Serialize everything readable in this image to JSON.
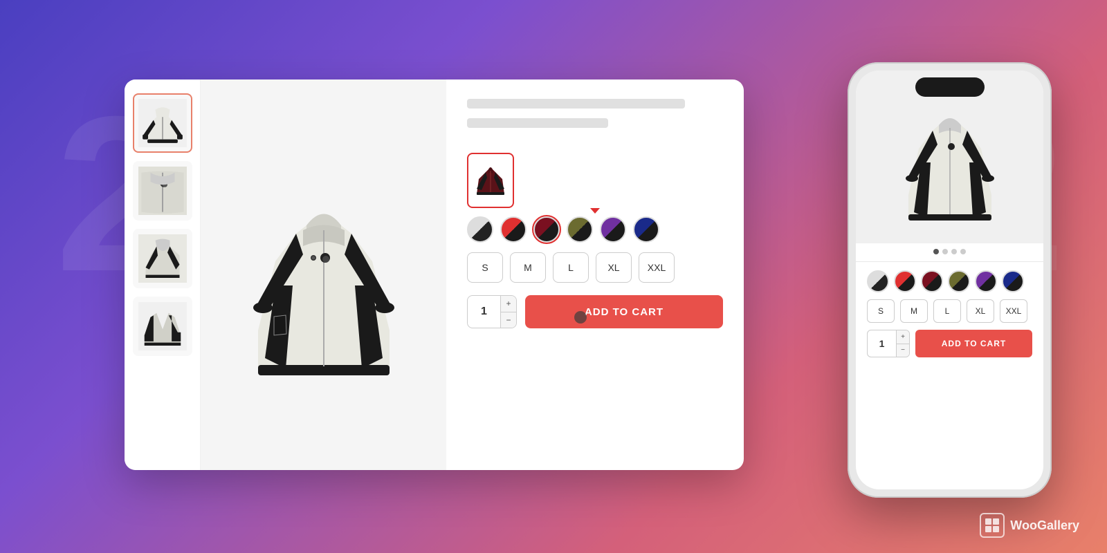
{
  "background": {
    "gradient_start": "#4a3fc0",
    "gradient_end": "#e8806a",
    "bg_text_left": "2",
    "bg_text_right": "2"
  },
  "desktop_card": {
    "thumbnails": [
      {
        "id": 1,
        "active": true,
        "alt": "Front view"
      },
      {
        "id": 2,
        "active": false,
        "alt": "Zipper detail"
      },
      {
        "id": 3,
        "active": false,
        "alt": "Side view"
      },
      {
        "id": 4,
        "active": false,
        "alt": "Back view"
      }
    ],
    "main_image_alt": "White hoodie jacket main view",
    "product": {
      "colors": [
        {
          "name": "white-black",
          "color1": "#ddd",
          "color2": "#222",
          "active": false
        },
        {
          "name": "red-black",
          "color1": "#e03030",
          "color2": "#1a1a1a",
          "active": false
        },
        {
          "name": "dark-red-black",
          "color1": "#7a1020",
          "color2": "#1a1a1a",
          "active": true
        },
        {
          "name": "olive-black",
          "color1": "#6b6b30",
          "color2": "#1a1a1a",
          "active": false
        },
        {
          "name": "purple-black",
          "color1": "#7030a0",
          "color2": "#1a1a1a",
          "active": false
        },
        {
          "name": "blue-black",
          "color1": "#1a2a8a",
          "color2": "#1a1a1a",
          "active": false
        }
      ],
      "sizes": [
        "S",
        "M",
        "L",
        "XL",
        "XXL"
      ],
      "quantity": "1",
      "add_to_cart_label": "ADD TO CART",
      "qty_plus": "+",
      "qty_minus": "−"
    }
  },
  "mobile_card": {
    "dots": [
      {
        "active": true
      },
      {
        "active": false
      },
      {
        "active": false
      },
      {
        "active": false
      }
    ],
    "product": {
      "colors": [
        {
          "name": "white-black",
          "color1": "#ddd",
          "color2": "#222",
          "active": false
        },
        {
          "name": "red-black",
          "color1": "#e03030",
          "color2": "#1a1a1a",
          "active": false
        },
        {
          "name": "dark-red-black",
          "color1": "#7a1020",
          "color2": "#1a1a1a",
          "active": false
        },
        {
          "name": "olive-black",
          "color1": "#6b6b30",
          "color2": "#1a1a1a",
          "active": false
        },
        {
          "name": "purple-black",
          "color1": "#7030a0",
          "color2": "#1a1a1a",
          "active": false
        },
        {
          "name": "blue-black",
          "color1": "#1a2a8a",
          "color2": "#1a1a1a",
          "active": false
        }
      ],
      "sizes": [
        "S",
        "M",
        "L",
        "XL",
        "XXL"
      ],
      "quantity": "1",
      "add_to_cart_label": "ADD TO CART",
      "qty_plus": "+",
      "qty_minus": "−"
    }
  },
  "woogallery": {
    "label": "WooGallery"
  },
  "cursor_color": "rgba(50,50,50,0.75)"
}
